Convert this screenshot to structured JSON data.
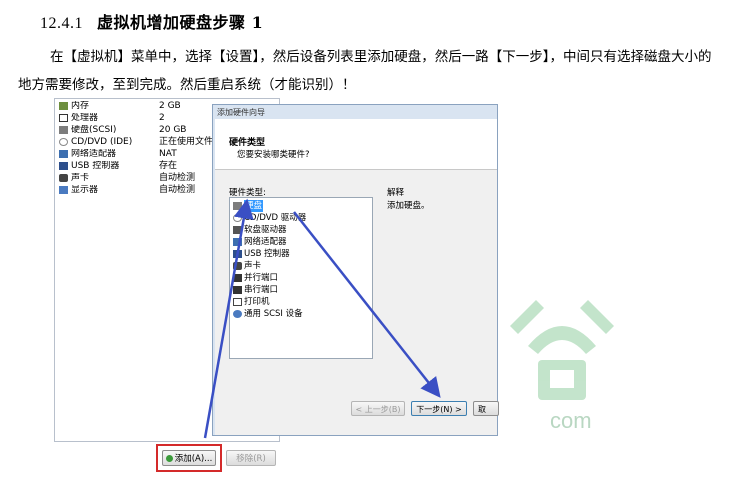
{
  "heading": {
    "number": "12.4.1",
    "title": "虚拟机增加硬盘步骤 1"
  },
  "paragraph": "在【虚拟机】菜单中，选择【设置】，然后设备列表里添加硬盘，然后一路【下一步】，中间只有选择磁盘大小的地方需要修改，至到完成。然后重启系统（才能识别）！",
  "device_list": [
    {
      "name": "内存",
      "summary": "2 GB",
      "icon": "memory-icon"
    },
    {
      "name": "处理器",
      "summary": "2",
      "icon": "processor-icon"
    },
    {
      "name": "硬盘(SCSI)",
      "summary": "20 GB",
      "icon": "hard-disk-icon"
    },
    {
      "name": "CD/DVD (IDE)",
      "summary": "正在使用文件 E:\\tod",
      "icon": "cd-icon"
    },
    {
      "name": "网络适配器",
      "summary": "NAT",
      "icon": "network-icon"
    },
    {
      "name": "USB 控制器",
      "summary": "存在",
      "icon": "usb-icon"
    },
    {
      "name": "声卡",
      "summary": "自动检测",
      "icon": "sound-icon"
    },
    {
      "name": "显示器",
      "summary": "自动检测",
      "icon": "display-icon"
    }
  ],
  "wizard": {
    "title": "添加硬件向导",
    "header_title": "硬件类型",
    "header_subtitle": "您要安装哪类硬件?",
    "list_label": "硬件类型:",
    "items": [
      "硬盘",
      "CD/DVD 驱动器",
      "软盘驱动器",
      "网络适配器",
      "USB 控制器",
      "声卡",
      "并行端口",
      "串行端口",
      "打印机",
      "通用 SCSI 设备"
    ],
    "selected_item": "硬盘",
    "description_label": "解释",
    "description_text": "添加硬盘。",
    "back_button": "< 上一步(B)",
    "next_button": "下一步(N) >",
    "cancel_button": "取"
  },
  "buttons": {
    "add": "添加(A)...",
    "remove": "移除(R)"
  },
  "colors": {
    "highlight_box": "#d42a2a",
    "arrow": "#3a4fc4",
    "selection": "#3399ff"
  },
  "watermark_text": "com"
}
